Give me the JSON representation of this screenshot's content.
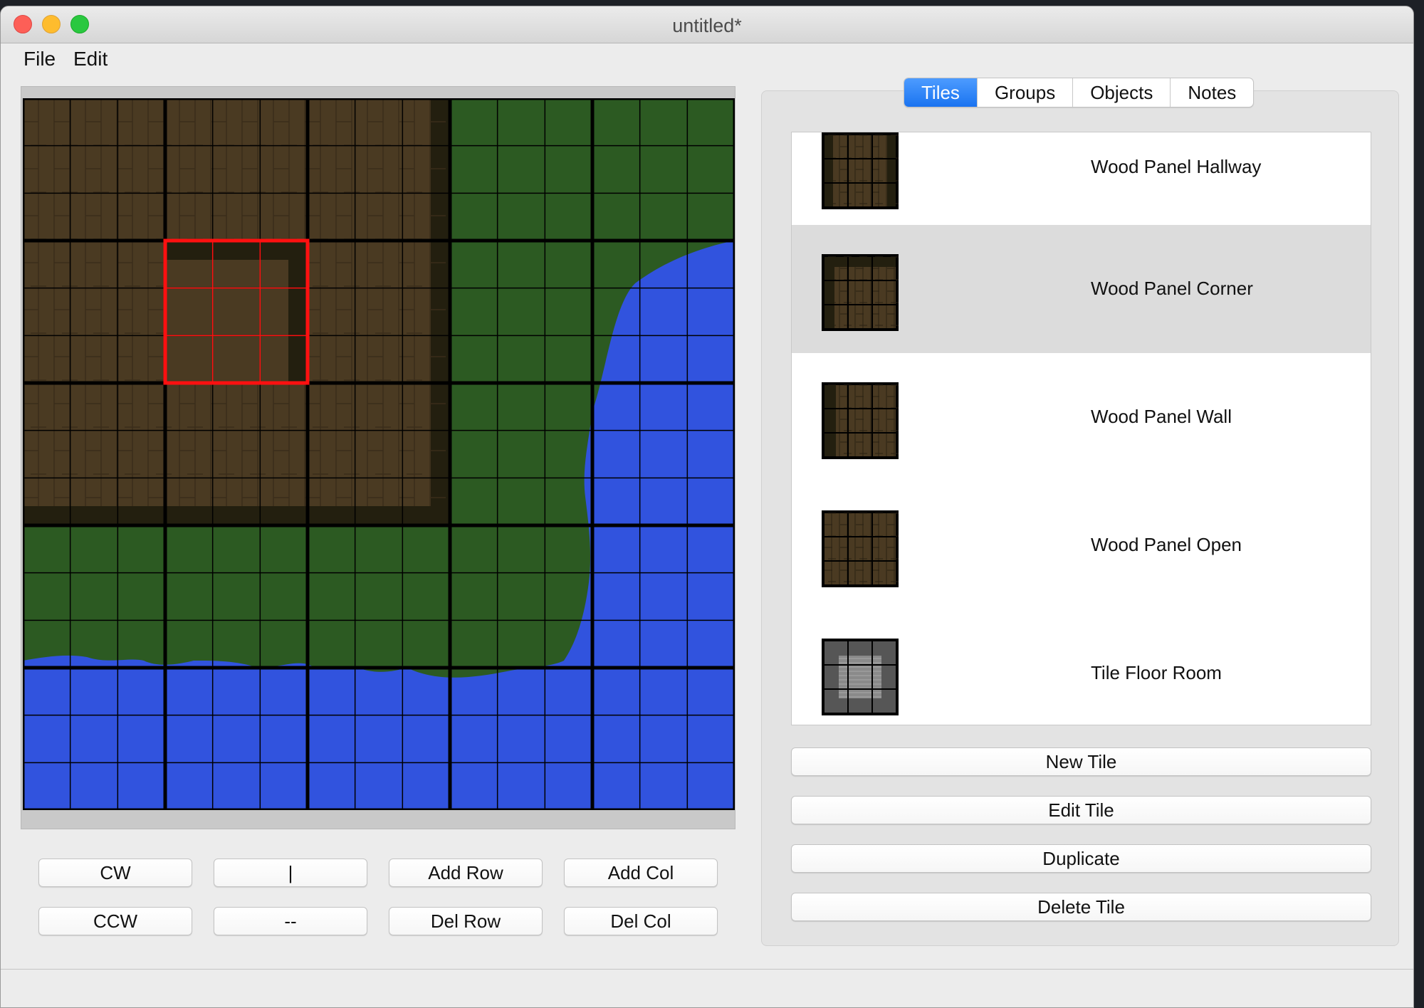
{
  "window": {
    "title": "untitled*"
  },
  "menubar": {
    "file": "File",
    "edit": "Edit"
  },
  "tabs": [
    "Tiles",
    "Groups",
    "Objects",
    "Notes"
  ],
  "tiles": [
    {
      "name": "Wood Panel Hallway",
      "type": "hallway",
      "selected": false
    },
    {
      "name": "Wood Panel Corner",
      "type": "corner",
      "selected": true
    },
    {
      "name": "Wood Panel Wall",
      "type": "wall",
      "selected": false
    },
    {
      "name": "Wood Panel Open",
      "type": "open",
      "selected": false
    },
    {
      "name": "Tile Floor Room",
      "type": "stone",
      "selected": false
    }
  ],
  "tile_buttons": {
    "new": "New Tile",
    "edit": "Edit Tile",
    "duplicate": "Duplicate",
    "delete": "Delete Tile"
  },
  "map_buttons": {
    "cw": "CW",
    "flip_v": "|",
    "add_row": "Add Row",
    "add_col": "Add Col",
    "ccw": "CCW",
    "flip_h": "--",
    "del_row": "Del Row",
    "del_col": "Del Col"
  },
  "map": {
    "cols": 5,
    "rows": 5,
    "selected_cell": {
      "row": 1,
      "col": 1
    }
  },
  "colors": {
    "wood": "#4a3a22",
    "wood_dark": "#231f0f",
    "grass": "#2c5a22",
    "water": "#3153de",
    "selection": "#ff1010",
    "accent": "#1a73f0"
  }
}
